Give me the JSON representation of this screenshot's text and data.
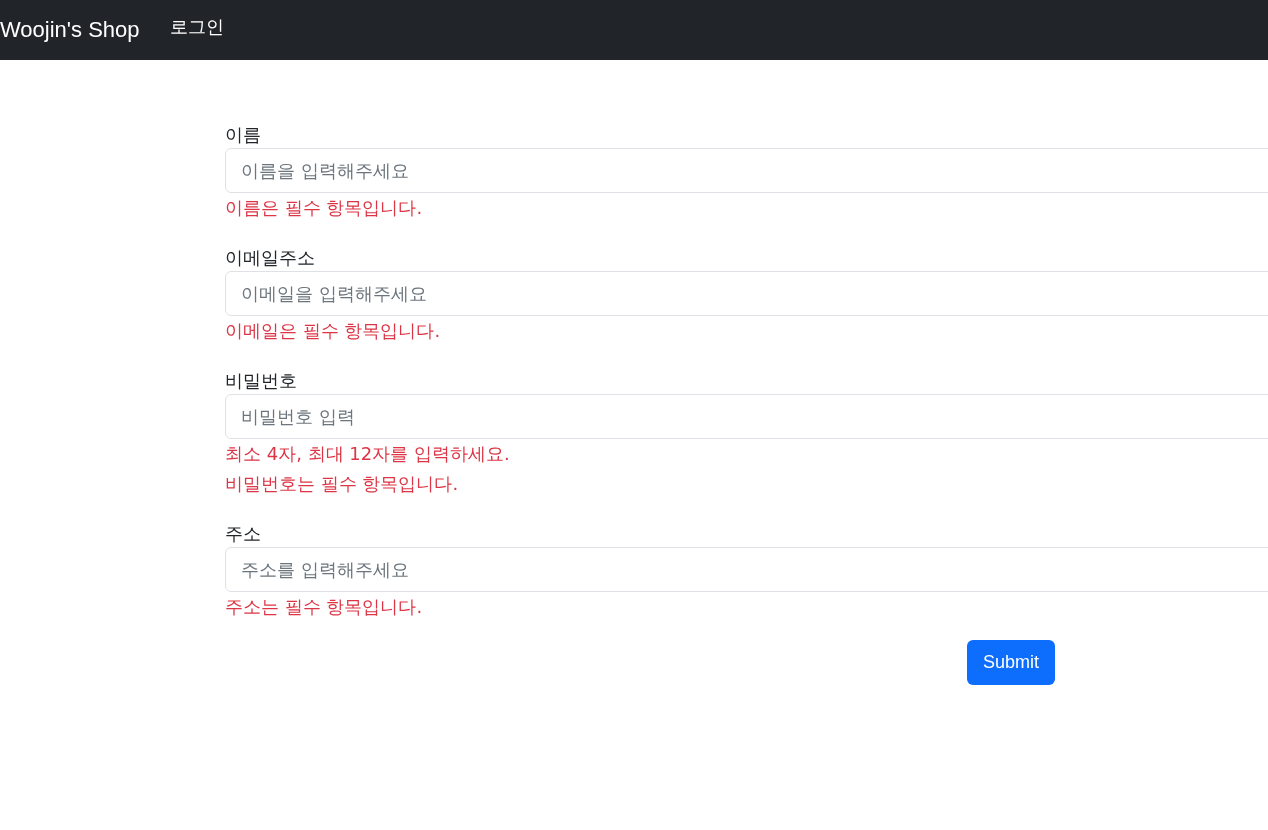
{
  "navbar": {
    "brand": "Woojin's Shop",
    "links": [
      {
        "label": "로그인"
      }
    ]
  },
  "form": {
    "fields": [
      {
        "label": "이름",
        "placeholder": "이름을 입력해주세요",
        "errors": [
          "이름은 필수 항목입니다."
        ]
      },
      {
        "label": "이메일주소",
        "placeholder": "이메일을 입력해주세요",
        "errors": [
          "이메일은 필수 항목입니다."
        ]
      },
      {
        "label": "비밀번호",
        "placeholder": "비밀번호 입력",
        "errors": [
          "최소 4자, 최대 12자를 입력하세요.",
          "비밀번호는 필수 항목입니다."
        ]
      },
      {
        "label": "주소",
        "placeholder": "주소를 입력해주세요",
        "errors": [
          "주소는 필수 항목입니다."
        ]
      }
    ],
    "submit": "Submit"
  }
}
